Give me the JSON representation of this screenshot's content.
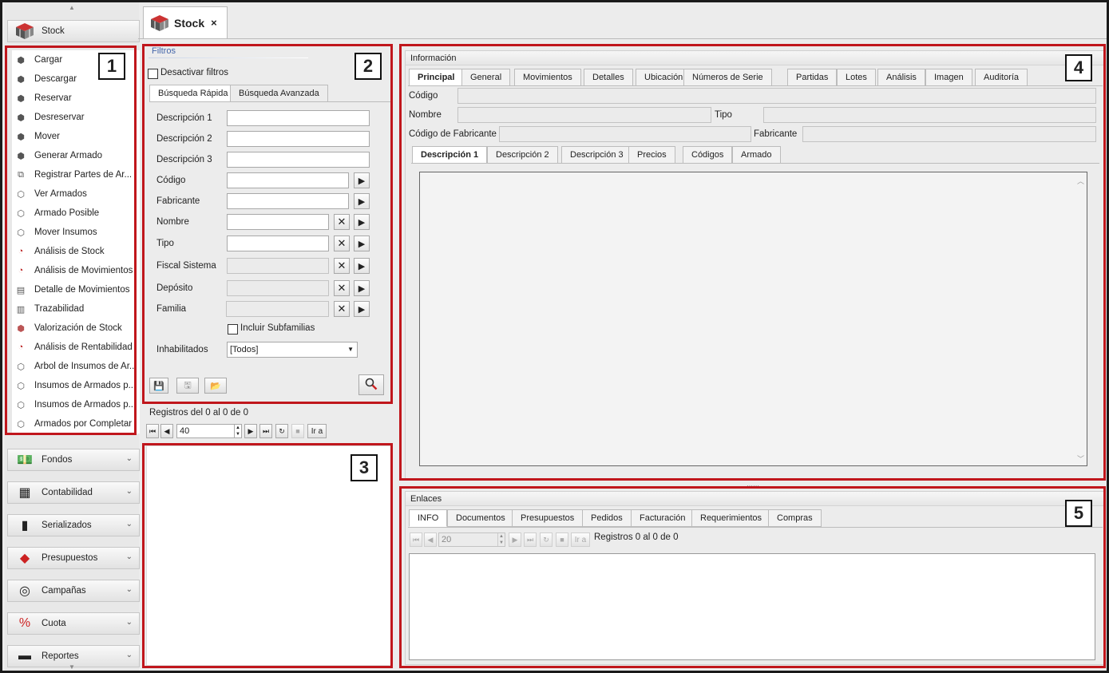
{
  "sidebar": {
    "active_group": {
      "label": "Stock",
      "icon": "stock-cube-icon"
    },
    "items": [
      {
        "label": "Cargar",
        "icon": "cube-icon"
      },
      {
        "label": "Descargar",
        "icon": "cube-icon"
      },
      {
        "label": "Reservar",
        "icon": "cube-icon"
      },
      {
        "label": "Desreservar",
        "icon": "cube-icon"
      },
      {
        "label": "Mover",
        "icon": "cube-icon"
      },
      {
        "label": "Generar Armado",
        "icon": "cube-icon"
      },
      {
        "label": "Registrar Partes de Ar...",
        "icon": "parts-icon"
      },
      {
        "label": "Ver Armados",
        "icon": "assembly-icon"
      },
      {
        "label": "Armado Posible",
        "icon": "assembly-icon"
      },
      {
        "label": "Mover Insumos",
        "icon": "assembly-icon"
      },
      {
        "label": "Análisis de Stock",
        "icon": "pie-chart-icon"
      },
      {
        "label": "Análisis de Movimientos",
        "icon": "pie-chart-icon"
      },
      {
        "label": "Detalle de Movimientos",
        "icon": "detail-icon"
      },
      {
        "label": "Trazabilidad",
        "icon": "trace-icon"
      },
      {
        "label": "Valorización de Stock",
        "icon": "valuation-icon"
      },
      {
        "label": "Análisis de Rentabilidad",
        "icon": "pie-chart-icon"
      },
      {
        "label": "Arbol de Insumos de Ar...",
        "icon": "tree-icon"
      },
      {
        "label": "Insumos de Armados p...",
        "icon": "assembly-icon"
      },
      {
        "label": "Insumos de Armados p...",
        "icon": "assembly-icon"
      },
      {
        "label": "Armados por Completar",
        "icon": "assembly-icon"
      }
    ],
    "groups": [
      {
        "label": "Fondos",
        "icon": "money-icon"
      },
      {
        "label": "Contabilidad",
        "icon": "abacus-icon"
      },
      {
        "label": "Serializados",
        "icon": "barcode-icon"
      },
      {
        "label": "Presupuestos",
        "icon": "budget-icon"
      },
      {
        "label": "Campañas",
        "icon": "target-icon"
      },
      {
        "label": "Cuota",
        "icon": "percent-icon"
      },
      {
        "label": "Reportes",
        "icon": "printer-icon"
      }
    ]
  },
  "tab": {
    "label": "Stock",
    "close": "×"
  },
  "filters": {
    "title": "Filtros",
    "disable_label": "Desactivar filtros",
    "tabs": [
      "Búsqueda Rápida",
      "Búsqueda Avanzada"
    ],
    "fields": {
      "desc1": "Descripción 1",
      "desc2": "Descripción 2",
      "desc3": "Descripción 3",
      "codigo": "Código",
      "fabricante": "Fabricante",
      "nombre": "Nombre",
      "tipo": "Tipo",
      "fiscal": "Fiscal Sistema",
      "deposito": "Depósito",
      "familia": "Familia",
      "subfamilias": "Incluir Subfamilias",
      "inhabilitados": "Inhabilitados",
      "inhabilitados_value": "[Todos]"
    }
  },
  "grid": {
    "records": "Registros del 0 al 0 de 0",
    "page_size": "40",
    "goto": "Ir a"
  },
  "info": {
    "title": "Información",
    "tabs": [
      "Principal",
      "General",
      "Movimientos",
      "Detalles",
      "Ubicación",
      "Números de Serie",
      "Partidas",
      "Lotes",
      "Análisis",
      "Imagen",
      "Auditoría"
    ],
    "labels": {
      "codigo": "Código",
      "nombre": "Nombre",
      "tipo": "Tipo",
      "cod_fab": "Código de Fabricante",
      "fabricante": "Fabricante"
    },
    "desc_tabs": [
      "Descripción 1",
      "Descripción 2",
      "Descripción 3",
      "Precios",
      "Códigos",
      "Armado"
    ]
  },
  "links": {
    "title": "Enlaces",
    "tabs": [
      "INFO",
      "Documentos",
      "Presupuestos",
      "Pedidos",
      "Facturación",
      "Requerimientos",
      "Compras"
    ],
    "page_size": "20",
    "goto": "Ir a",
    "records": "Registros 0 al 0 de 0"
  },
  "badges": [
    "1",
    "2",
    "3",
    "4",
    "5"
  ],
  "colors": {
    "highlight": "#c0161c"
  }
}
